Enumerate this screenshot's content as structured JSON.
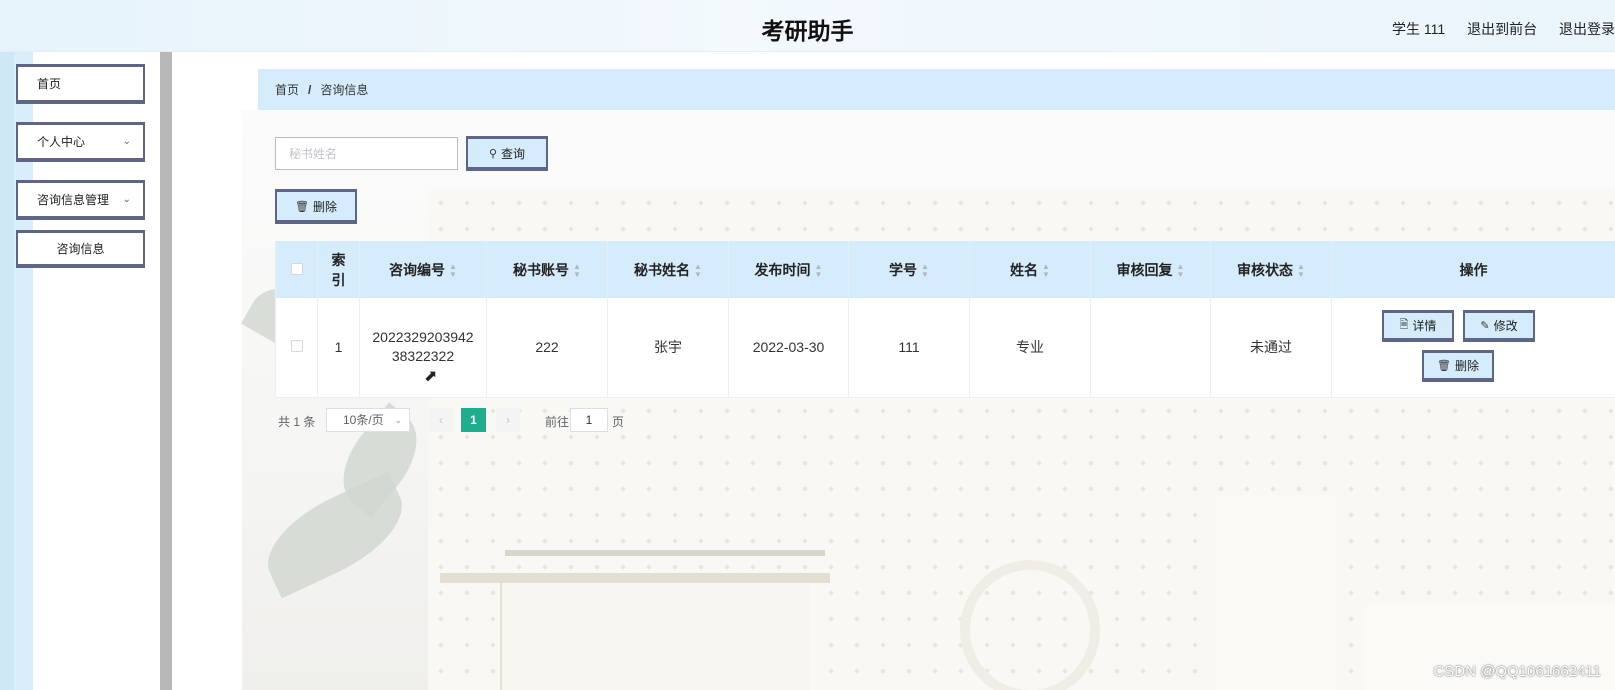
{
  "header": {
    "title": "考研助手",
    "user_label": "学生 111",
    "front_link": "退出到前台",
    "logout_link": "退出登录"
  },
  "sidebar": {
    "items": [
      {
        "label": "首页"
      },
      {
        "label": "个人中心",
        "has_children": true
      },
      {
        "label": "咨询信息管理",
        "has_children": true
      },
      {
        "label": "咨询信息"
      }
    ]
  },
  "breadcrumb": {
    "home": "首页",
    "separator": "/",
    "current": "咨询信息"
  },
  "search": {
    "placeholder": "秘书姓名",
    "button_label": "查询"
  },
  "toolbar": {
    "delete_label": "删除"
  },
  "table": {
    "columns": [
      "索引",
      "咨询编号",
      "秘书账号",
      "秘书姓名",
      "发布时间",
      "学号",
      "姓名",
      "审核回复",
      "审核状态",
      "操作"
    ],
    "rows": [
      {
        "index": "1",
        "code_line1": "2022329203942",
        "code_line2": "38322322",
        "secretary_account": "222",
        "secretary_name": "张宇",
        "publish_time": "2022-03-30",
        "student_id": "111",
        "name": "专业",
        "review_reply": "",
        "review_status": "未通过",
        "actions": {
          "detail": "详情",
          "edit": "修改",
          "delete": "删除"
        }
      }
    ]
  },
  "pagination": {
    "total": "共 1 条",
    "page_size": "10条/页",
    "current_page": "1",
    "goto_label": "前往",
    "goto_value": "1",
    "page_suffix": "页"
  },
  "watermark": "CSDN @QQ1061662411",
  "colors": {
    "accent": "#d4ecfb",
    "button_border": "#5f6586",
    "active_page": "#1fae8c"
  }
}
